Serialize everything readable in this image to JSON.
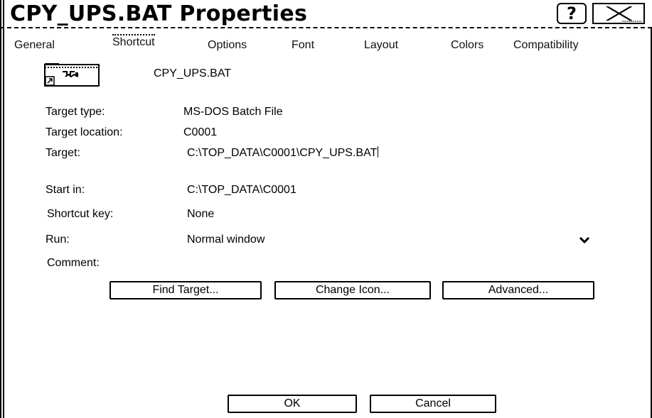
{
  "window": {
    "title": "CPY_UPS.BAT Properties",
    "help_label": "?"
  },
  "tabs": [
    {
      "label": "General",
      "active": false
    },
    {
      "label": "Shortcut",
      "active": true
    },
    {
      "label": "Options",
      "active": false
    },
    {
      "label": "Font",
      "active": false
    },
    {
      "label": "Layout",
      "active": false
    },
    {
      "label": "Colors",
      "active": false
    },
    {
      "label": "Compatibility",
      "active": false
    }
  ],
  "file": {
    "name": "CPY_UPS.BAT",
    "icon": "batch-file-shortcut-icon"
  },
  "fields": {
    "target_type": {
      "label": "Target type:",
      "value": "MS-DOS Batch File"
    },
    "target_location": {
      "label": "Target location:",
      "value": "C0001"
    },
    "target": {
      "label": "Target:",
      "value": "C:\\TOP_DATA\\C0001\\CPY_UPS.BAT"
    },
    "start_in": {
      "label": "Start in:",
      "value": "C:\\TOP_DATA\\C0001"
    },
    "shortcut_key": {
      "label": "Shortcut key:",
      "value": "None"
    },
    "run": {
      "label": "Run:",
      "value": "Normal window"
    },
    "comment": {
      "label": "Comment:",
      "value": ""
    }
  },
  "buttons": {
    "find_target": "Find Target...",
    "change_icon": "Change Icon...",
    "advanced": "Advanced...",
    "ok": "OK",
    "cancel": "Cancel"
  }
}
